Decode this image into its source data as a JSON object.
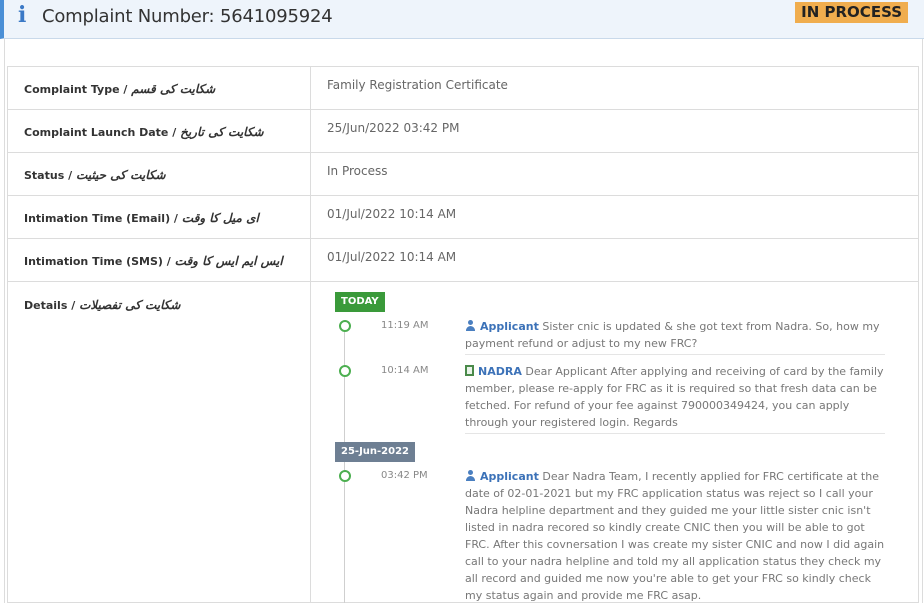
{
  "header": {
    "icon": "info-icon",
    "title": "Complaint Number: 5641095924",
    "status_badge": "IN PROCESS",
    "colors": {
      "accent": "#4a8fd6",
      "badge": "#f0ad4e"
    }
  },
  "rows": [
    {
      "label": "Complaint Type /",
      "label_urdu": "شکایت کی قسم",
      "value": "Family Registration Certificate"
    },
    {
      "label": "Complaint Launch Date /",
      "label_urdu": "شکایت کی تاریخ",
      "value": "25/Jun/2022 03:42 PM"
    },
    {
      "label": "Status /",
      "label_urdu": "شکایت کی حیثیت",
      "value": "In Process"
    },
    {
      "label": "Intimation Time (Email) /",
      "label_urdu": "ای میل کا وقت",
      "value": "01/Jul/2022 10:14 AM"
    },
    {
      "label": "Intimation Time (SMS) /",
      "label_urdu": "ایس ایم ایس کا وقت",
      "value": "01/Jul/2022 10:14 AM"
    }
  ],
  "details": {
    "label": "Details /",
    "label_urdu": "شکایت کی تفصیلات",
    "groups": [
      {
        "date_tag": "TODAY",
        "entries": [
          {
            "time": "11:19 AM",
            "author": "Applicant",
            "icon": "user-icon",
            "text": "Sister cnic is updated & she got text from Nadra. So, how my payment refund or adjust to my new FRC?"
          },
          {
            "time": "10:14 AM",
            "author": "NADRA",
            "icon": "nadra-icon",
            "text": "Dear Applicant After applying and receiving of card by the family member, please re-apply for FRC as it is required so that fresh data can be fetched. For refund of your fee against 790000349424, you can apply through your registered login. Regards"
          }
        ]
      },
      {
        "date_tag": "25-Jun-2022",
        "entries": [
          {
            "time": "03:42 PM",
            "author": "Applicant",
            "icon": "user-icon",
            "text": "Dear Nadra Team, I recently applied for FRC certificate at the date of 02-01-2021 but my FRC application status was reject so I call your Nadra helpline department and they guided me your little sister cnic isn't listed in nadra recored so kindly create CNIC then you will be able to got FRC. After this covnersation I was create my sister CNIC and now I did again call to your nadra helpline and told my all application status they check my all record and guided me now you're able to get your FRC so kindly check my status again and provide me FRC asap."
          }
        ]
      }
    ]
  }
}
